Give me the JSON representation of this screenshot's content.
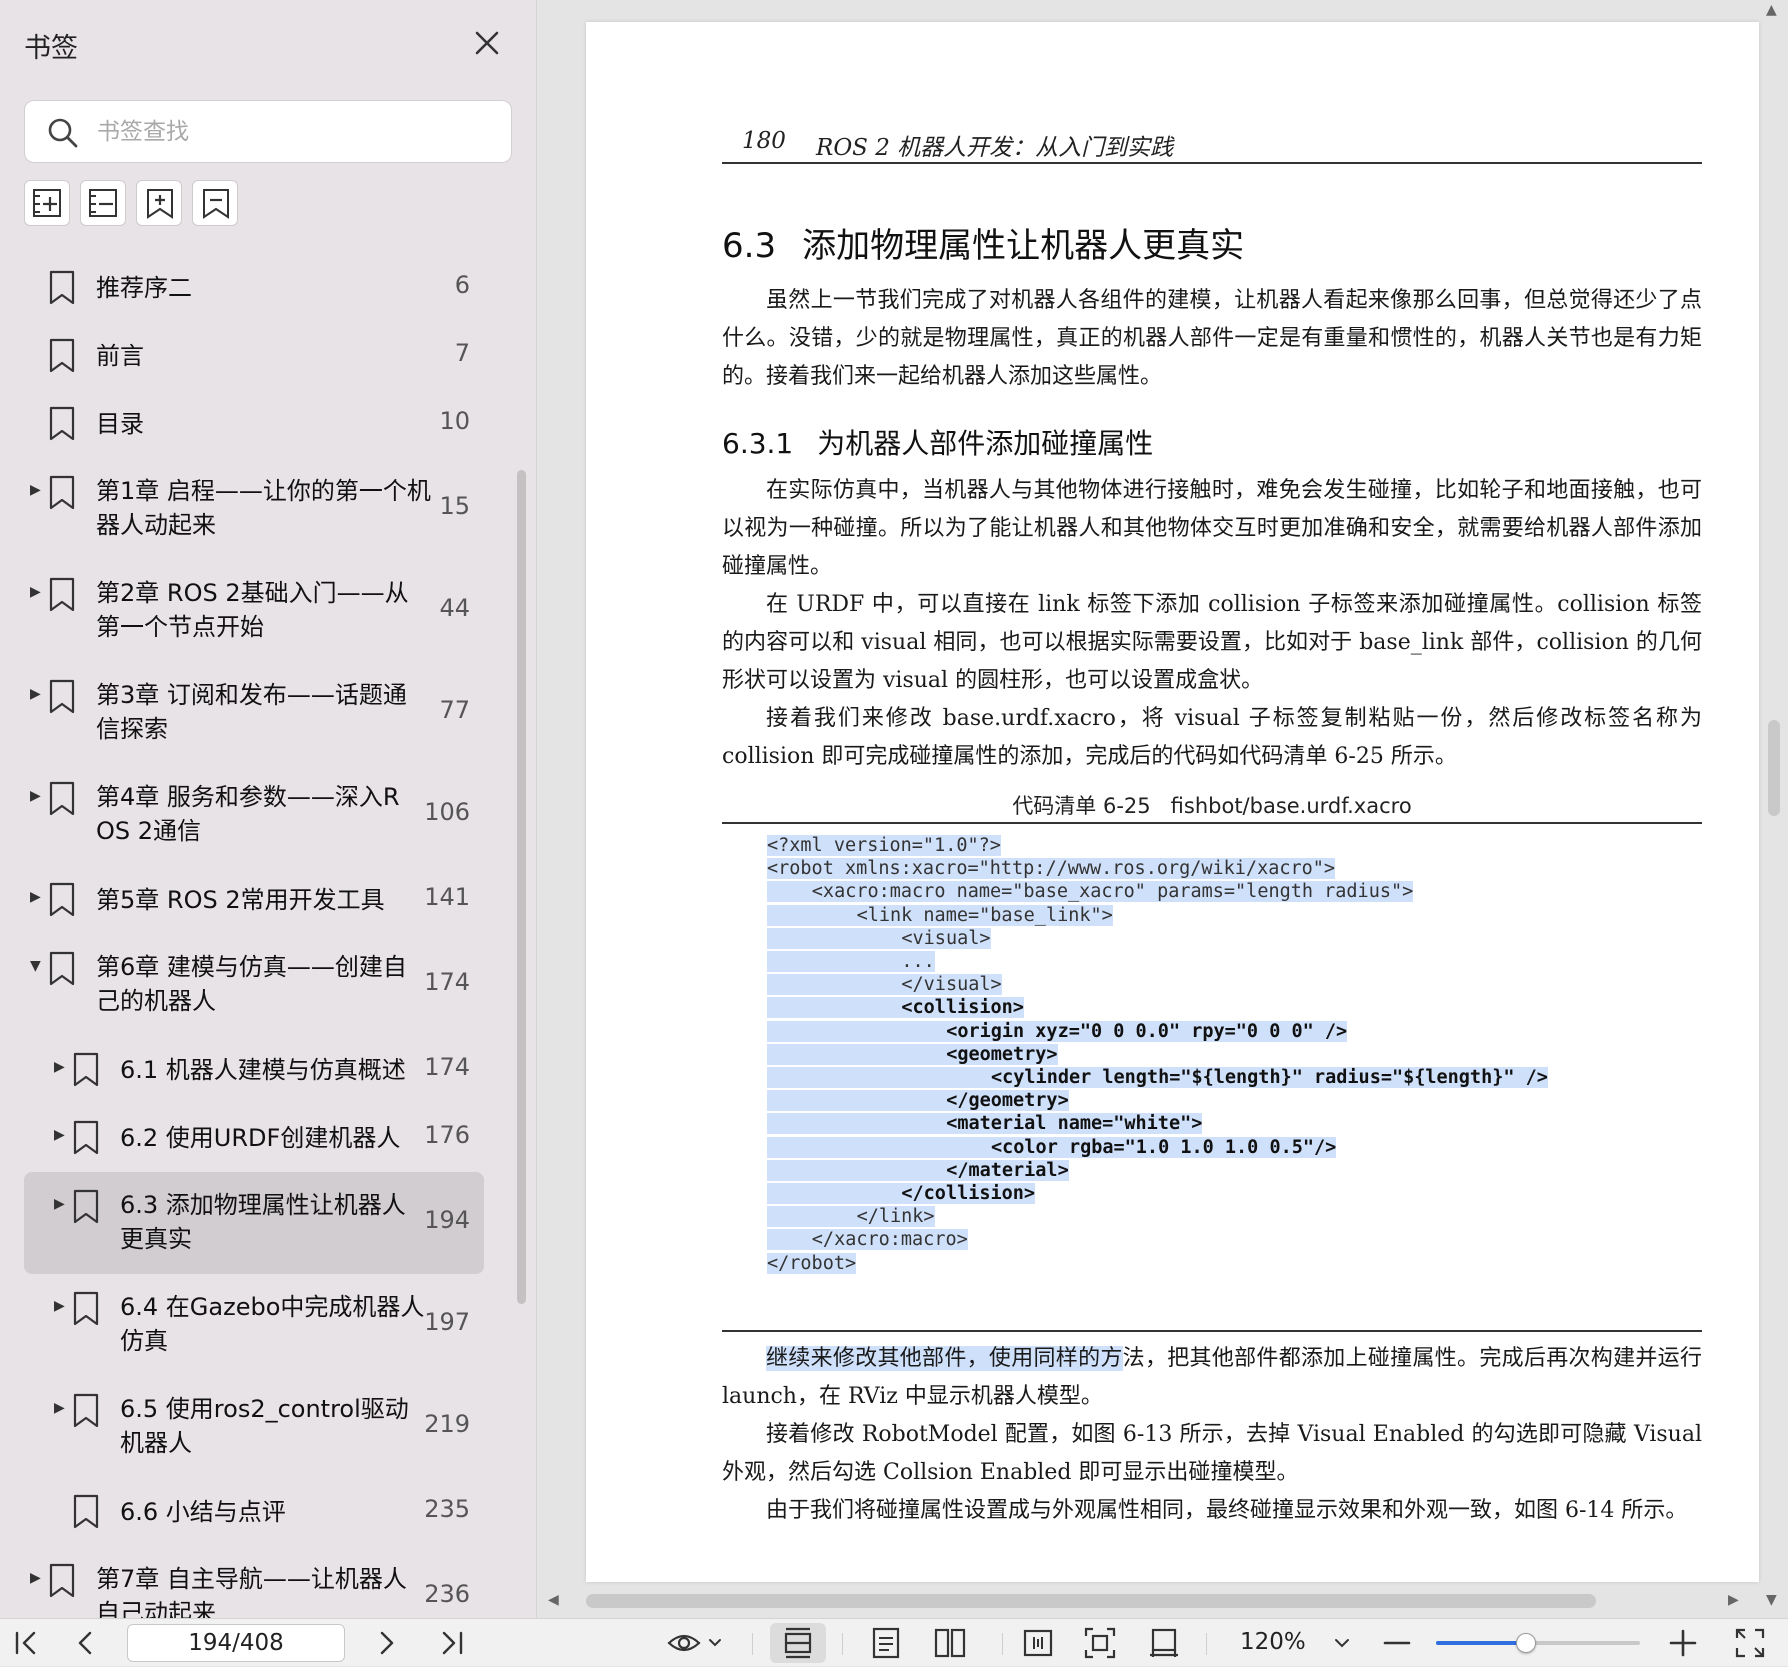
{
  "sidebar": {
    "title": "书签",
    "search_placeholder": "书签查找",
    "bookmarks": [
      {
        "label1": "推荐序二",
        "label2": "",
        "page": "6",
        "level": 0,
        "arrow": ""
      },
      {
        "label1": "前言",
        "label2": "",
        "page": "7",
        "level": 0,
        "arrow": ""
      },
      {
        "label1": "目录",
        "label2": "",
        "page": "10",
        "level": 0,
        "arrow": ""
      },
      {
        "label1": "第1章 启程——让你的第一个机",
        "label2": "器人动起来",
        "page": "15",
        "level": 0,
        "arrow": "▶"
      },
      {
        "label1": "第2章 ROS 2基础入门——从",
        "label2": "第一个节点开始",
        "page": "44",
        "level": 0,
        "arrow": "▶"
      },
      {
        "label1": "第3章 订阅和发布——话题通",
        "label2": "信探索",
        "page": "77",
        "level": 0,
        "arrow": "▶"
      },
      {
        "label1": "第4章 服务和参数——深入R",
        "label2": "OS 2通信",
        "page": "106",
        "level": 0,
        "arrow": "▶"
      },
      {
        "label1": "第5章 ROS 2常用开发工具",
        "label2": "",
        "page": "141",
        "level": 0,
        "arrow": "▶"
      },
      {
        "label1": "第6章 建模与仿真——创建自",
        "label2": "己的机器人",
        "page": "174",
        "level": 0,
        "arrow": "▼"
      },
      {
        "label1": "6.1 机器人建模与仿真概述",
        "label2": "",
        "page": "174",
        "level": 1,
        "arrow": "▶"
      },
      {
        "label1": "6.2 使用URDF创建机器人",
        "label2": "",
        "page": "176",
        "level": 1,
        "arrow": "▶"
      },
      {
        "label1": "6.3 添加物理属性让机器人",
        "label2": "更真实",
        "page": "194",
        "level": 1,
        "arrow": "▶",
        "selected": true
      },
      {
        "label1": "6.4 在Gazebo中完成机器人",
        "label2": "仿真",
        "page": "197",
        "level": 1,
        "arrow": "▶"
      },
      {
        "label1": "6.5 使用ros2_control驱动",
        "label2": "机器人",
        "page": "219",
        "level": 1,
        "arrow": "▶"
      },
      {
        "label1": "6.6 小结与点评",
        "label2": "",
        "page": "235",
        "level": 1,
        "arrow": ""
      },
      {
        "label1": "第7章 自主导航——让机器人",
        "label2": "自己动起来",
        "page": "236",
        "level": 0,
        "arrow": "▶"
      }
    ]
  },
  "document": {
    "page_number": "180",
    "book_title": "ROS 2 机器人开发：从入门到实践",
    "section_number": "6.3",
    "section_title": "添加物理属性让机器人更真实",
    "intro": "虽然上一节我们完成了对机器人各组件的建模，让机器人看起来像那么回事，但总觉得还少了点什么。没错，少的就是物理属性，真正的机器人部件一定是有重量和惯性的，机器人关节也是有力矩的。接着我们来一起给机器人添加这些属性。",
    "subsection_number": "6.3.1",
    "subsection_title": "为机器人部件添加碰撞属性",
    "p1": "在实际仿真中，当机器人与其他物体进行接触时，难免会发生碰撞，比如轮子和地面接触，也可以视为一种碰撞。所以为了能让机器人和其他物体交互时更加准确和安全，就需要给机器人部件添加碰撞属性。",
    "p2": "在 URDF 中，可以直接在 link 标签下添加 collision 子标签来添加碰撞属性。collision 标签的内容可以和 visual 相同，也可以根据实际需要设置，比如对于 base_link 部件，collision 的几何形状可以设置为 visual 的圆柱形，也可以设置成盒状。",
    "p3": "接着我们来修改 base.urdf.xacro，将 visual 子标签复制粘贴一份，然后修改标签名称为 collision 即可完成碰撞属性的添加，完成后的代码如代码清单 6-25 所示。",
    "code_caption_label": "代码清单 6-25",
    "code_caption_file": "fishbot/base.urdf.xacro",
    "code_lines": [
      {
        "indent": 0,
        "text": "<?xml version=\"1.0\"?>",
        "bold": false
      },
      {
        "indent": 0,
        "text": "<robot xmlns:xacro=\"http://www.ros.org/wiki/xacro\">",
        "bold": false
      },
      {
        "indent": 4,
        "text": "<xacro:macro name=\"base_xacro\" params=\"length radius\">",
        "bold": false
      },
      {
        "indent": 8,
        "text": "<link name=\"base_link\">",
        "bold": false
      },
      {
        "indent": 12,
        "text": "<visual>",
        "bold": false
      },
      {
        "indent": 12,
        "text": "...",
        "bold": false
      },
      {
        "indent": 12,
        "text": "</visual>",
        "bold": false
      },
      {
        "indent": 12,
        "text": "<collision>",
        "bold": true
      },
      {
        "indent": 16,
        "text": "<origin xyz=\"0 0 0.0\" rpy=\"0 0 0\" />",
        "bold": true
      },
      {
        "indent": 16,
        "text": "<geometry>",
        "bold": true
      },
      {
        "indent": 20,
        "text": "<cylinder length=\"${length}\" radius=\"${length}\" />",
        "bold": true
      },
      {
        "indent": 16,
        "text": "</geometry>",
        "bold": true
      },
      {
        "indent": 16,
        "text": "<material name=\"white\">",
        "bold": true
      },
      {
        "indent": 20,
        "text": "<color rgba=\"1.0 1.0 1.0 0.5\"/>",
        "bold": true
      },
      {
        "indent": 16,
        "text": "</material>",
        "bold": true
      },
      {
        "indent": 12,
        "text": "</collision>",
        "bold": true
      },
      {
        "indent": 8,
        "text": "</link>",
        "bold": false
      },
      {
        "indent": 4,
        "text": "</xacro:macro>",
        "bold": false
      },
      {
        "indent": 0,
        "text": "</robot>",
        "bold": false
      }
    ],
    "p4_highlight": "继续来修改其他部件，使用同样的方",
    "p4_rest": "法，把其他部件都添加上碰撞属性。完成后再次构建并运行 launch，在 RViz 中显示机器人模型。",
    "p5": "接着修改 RobotModel 配置，如图 6-13 所示，去掉 Visual Enabled 的勾选即可隐藏 Visual 外观，然后勾选 Collsion Enabled 即可显示出碰撞模型。",
    "p6": "由于我们将碰撞属性设置成与外观属性相同，最终碰撞显示效果和外观一致，如图 6-14 所示。"
  },
  "toolbar": {
    "page_value": "194/408",
    "zoom": "120%",
    "zoom_level": 0.44
  },
  "colors": {
    "selection": "#cfe0fa",
    "accent": "#2f6fe0",
    "sidebar_bg": "#e8e3e6"
  }
}
